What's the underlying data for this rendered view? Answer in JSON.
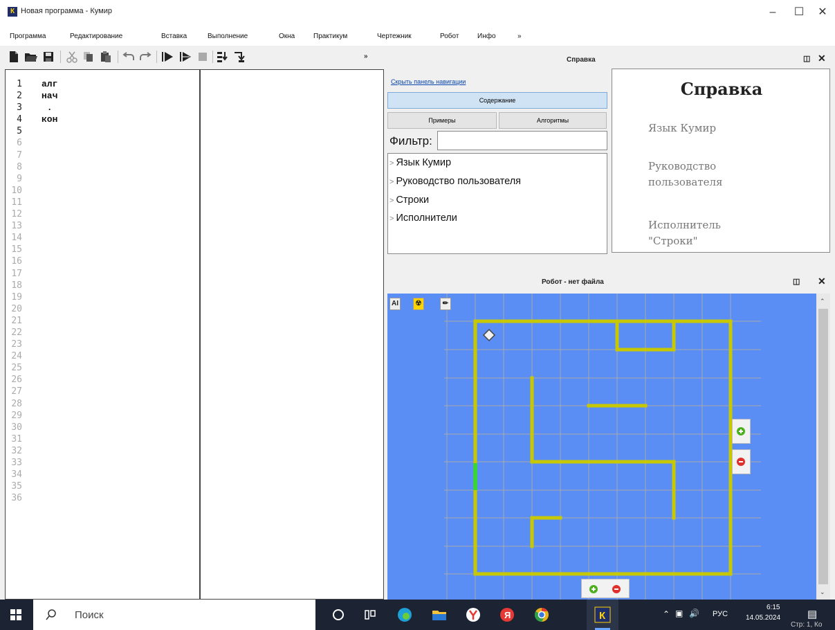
{
  "window": {
    "title": "Новая программа - Кумир",
    "logo": "К"
  },
  "menu": [
    "Программа",
    "Редактирование",
    "Вставка",
    "Выполнение",
    "Окна",
    "Практикум",
    "Чертежник",
    "Робот",
    "Инфо",
    "»"
  ],
  "toolbar": {
    "icons": [
      "new-file-icon",
      "open-folder-icon",
      "save-icon",
      "cut-icon",
      "copy-icon",
      "paste-icon",
      "undo-icon",
      "redo-icon",
      "run-icon",
      "run-step-icon",
      "stop-icon",
      "step-into-icon",
      "step-out-icon"
    ],
    "more": "»"
  },
  "editor": {
    "line_numbers": [
      "1",
      "2",
      "3",
      "4",
      "5",
      "6",
      "7",
      "8",
      "9",
      "10",
      "11",
      "12",
      "13",
      "14",
      "15",
      "16",
      "17",
      "18",
      "19",
      "20",
      "21",
      "22",
      "23",
      "24",
      "25",
      "26",
      "27",
      "28",
      "29",
      "30",
      "31",
      "32",
      "33",
      "34",
      "35",
      "36"
    ],
    "lines": [
      "алг",
      "нач",
      " .",
      "кон"
    ]
  },
  "help": {
    "panel_title": "Справка",
    "hide_nav_link": "Скрыть панель навигации",
    "contents_button": "Содержание",
    "examples_button": "Примеры",
    "algorithms_button": "Алгоритмы",
    "filter_label": "Фильтр:",
    "filter_value": "",
    "tree": [
      "Язык Кумир",
      "Руководство пользователя",
      "Строки",
      "Исполнители"
    ],
    "view_title": "Справка",
    "view_links": [
      "Язык Кумир",
      "Руководство\nпользователя",
      "Исполнитель\n\"Строки\""
    ]
  },
  "robot": {
    "panel_title": "Робот - нет файла",
    "tools": [
      "AI",
      "radiation-icon",
      "pen-icon"
    ],
    "colors": {
      "field": "#5b8ef5",
      "wall": "#c8c800",
      "painted": "#3cd23c",
      "grid": "#a8a8a8"
    }
  },
  "taskbar": {
    "search_text": "Поиск",
    "lang": "РУС",
    "time": "6:15",
    "date": "14.05.2024",
    "status_fragment": "Стр: 1, Ко"
  }
}
